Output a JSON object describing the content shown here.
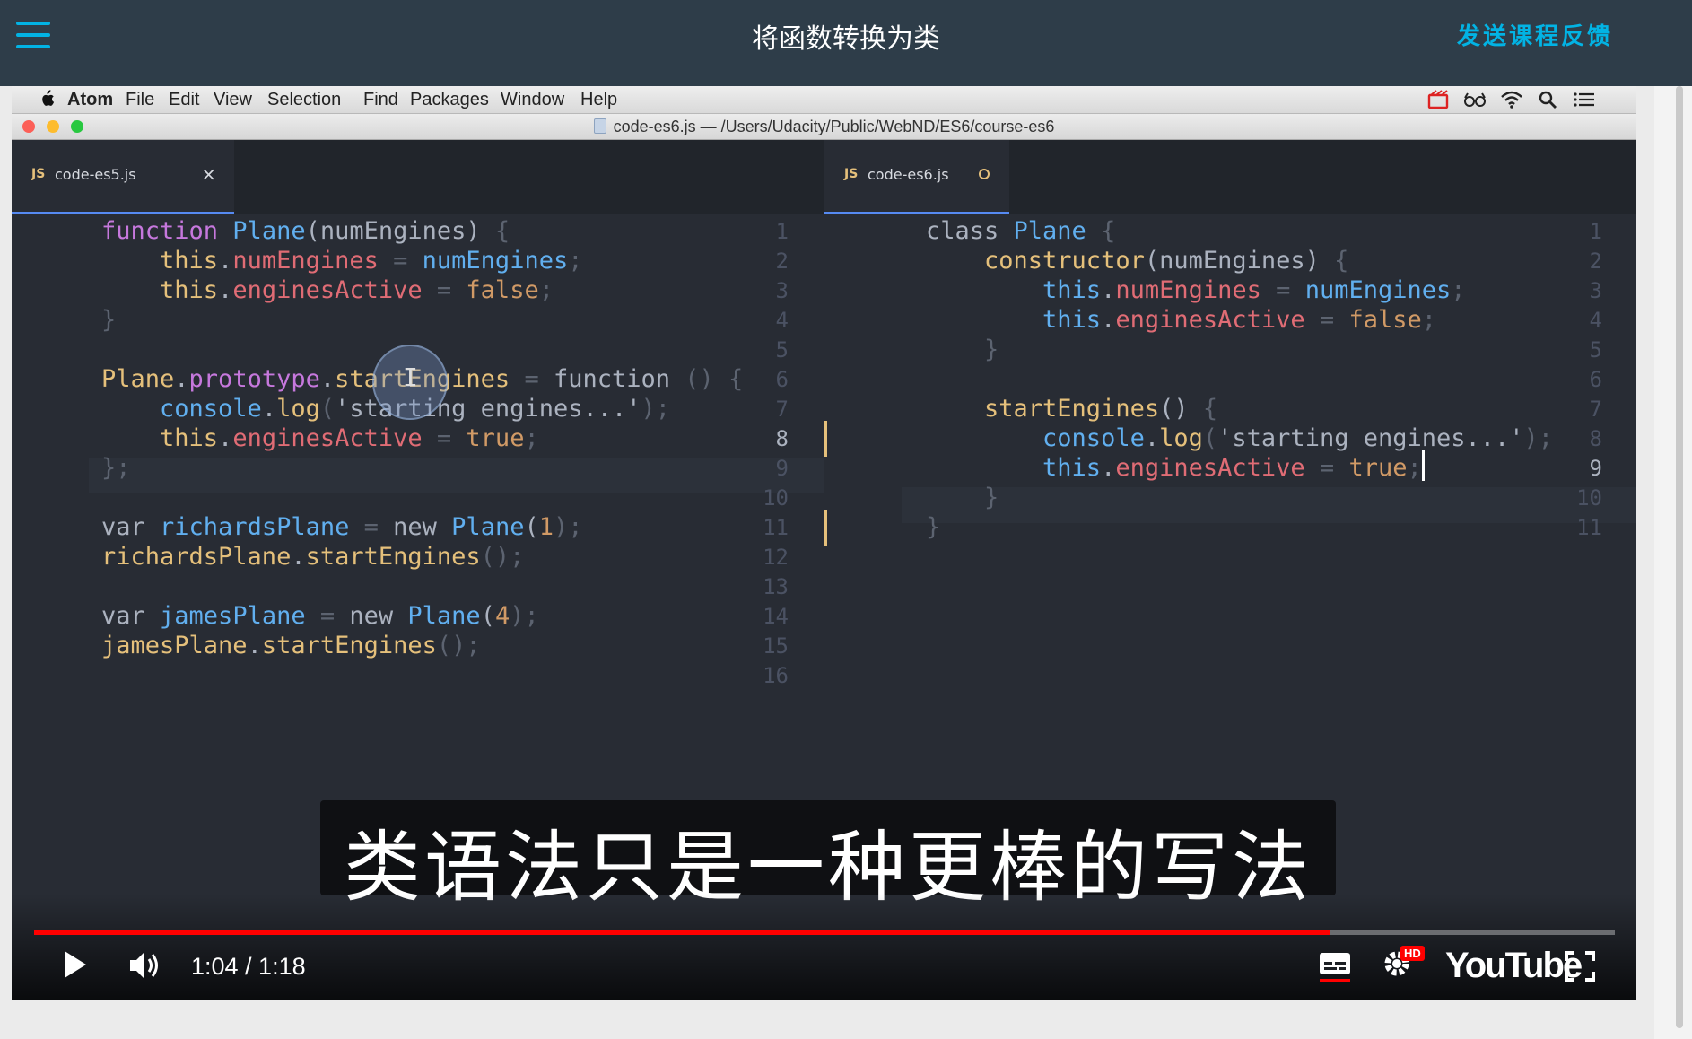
{
  "header": {
    "title": "将函数转换为类",
    "feedback_label": "发送课程反馈"
  },
  "menubar": {
    "app": "Atom",
    "items": [
      "File",
      "Edit",
      "View",
      "Selection",
      "Find",
      "Packages",
      "Window",
      "Help"
    ]
  },
  "window": {
    "title": "code-es6.js — /Users/Udacity/Public/WebND/ES6/course-es6"
  },
  "left_pane": {
    "tab": {
      "badge": "JS",
      "label": "code-es5.js",
      "close": "×"
    },
    "active_line": "8",
    "line_numbers": [
      "1",
      "2",
      "3",
      "4",
      "5",
      "6",
      "7",
      "8",
      "9",
      "10",
      "11",
      "12",
      "13",
      "14",
      "15",
      "16"
    ]
  },
  "right_pane": {
    "tab": {
      "badge": "JS",
      "label": "code-es6.js"
    },
    "active_line": "9",
    "line_numbers": [
      "1",
      "2",
      "3",
      "4",
      "5",
      "6",
      "7",
      "8",
      "9",
      "10",
      "11"
    ]
  },
  "code_left": {
    "l1": {
      "a": "function",
      "b": " Plane",
      "c": "(numEngines)",
      "d": " {"
    },
    "l2": {
      "a": "    this",
      "b": ".",
      "c": "numEngines",
      "d": " = ",
      "e": "numEngines",
      "f": ";"
    },
    "l3": {
      "a": "    this",
      "b": ".",
      "c": "enginesActive",
      "d": " = ",
      "e": "false",
      "f": ";"
    },
    "l4": {
      "a": "}"
    },
    "l6": {
      "a": "Plane",
      "b": ".",
      "c": "prototype",
      "d": ".",
      "e": "startEngines",
      "f": " = ",
      "g": "function",
      "h": " () {"
    },
    "l7": {
      "a": "    console",
      "b": ".",
      "c": "log",
      "d": "(",
      "e": "'starting engines...'",
      "f": ");"
    },
    "l8": {
      "a": "    this",
      "b": ".",
      "c": "enginesActive",
      "d": " = ",
      "e": "true",
      "f": ";"
    },
    "l9": {
      "a": "};"
    },
    "l11": {
      "a": "var",
      "b": " richardsPlane",
      "c": " = ",
      "d": "new",
      "e": " Plane",
      "f": "(",
      "g": "1",
      "h": ");"
    },
    "l12": {
      "a": "richardsPlane",
      "b": ".",
      "c": "startEngines",
      "d": "();"
    },
    "l14": {
      "a": "var",
      "b": " jamesPlane",
      "c": " = ",
      "d": "new",
      "e": " Plane",
      "f": "(",
      "g": "4",
      "h": ");"
    },
    "l15": {
      "a": "jamesPlane",
      "b": ".",
      "c": "startEngines",
      "d": "();"
    }
  },
  "code_right": {
    "l1": {
      "a": "class",
      "b": " Plane",
      "c": " {"
    },
    "l2": {
      "a": "    constructor",
      "b": "(numEngines)",
      "c": " {"
    },
    "l3": {
      "a": "        this",
      "b": ".",
      "c": "numEngines",
      "d": " = ",
      "e": "numEngines",
      "f": ";"
    },
    "l4": {
      "a": "        this",
      "b": ".",
      "c": "enginesActive",
      "d": " = ",
      "e": "false",
      "f": ";"
    },
    "l5": {
      "a": "    }"
    },
    "l7": {
      "a": "    startEngines",
      "b": "()",
      "c": " {"
    },
    "l8": {
      "a": "        console",
      "b": ".",
      "c": "log",
      "d": "(",
      "e": "'starting engines...'",
      "f": ");"
    },
    "l9": {
      "a": "        this",
      "b": ".",
      "c": "enginesActive",
      "d": " = ",
      "e": "true",
      "f": ";"
    },
    "l10": {
      "a": "    }"
    },
    "l11": {
      "a": "}"
    }
  },
  "subtitle": "类语法只是一种更棒的写法",
  "player": {
    "time": "1:04 / 1:18",
    "progress": 0.82,
    "hd_badge": "HD",
    "logo": "YouTube"
  },
  "icons": [
    "menu-icon",
    "apple-icon",
    "play-icon",
    "volume-icon",
    "captions-icon",
    "settings-icon",
    "fullscreen-icon"
  ],
  "colors": {
    "udacity_bar": "#2e3d49",
    "accent": "#02b3e4",
    "editor_bg": "#282c34",
    "progress_red": "#ff0000"
  }
}
